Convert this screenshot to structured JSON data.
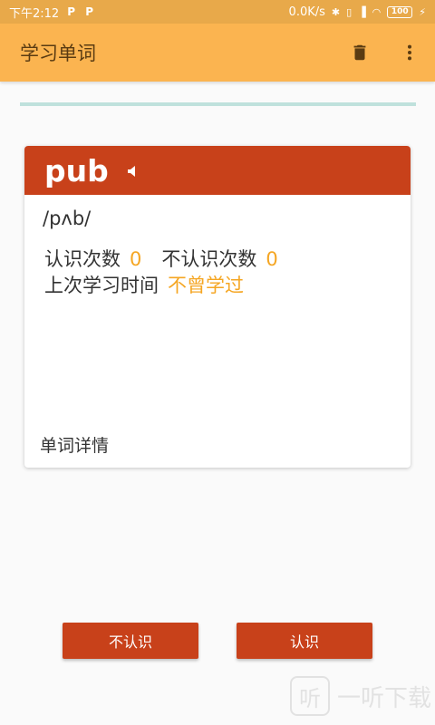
{
  "status_bar": {
    "time": "下午2:12",
    "notif_icons": [
      "P",
      "P"
    ],
    "net_speed": "0.0K/s",
    "battery": "100"
  },
  "app_bar": {
    "title": "学习单词",
    "actions": [
      "trash-icon",
      "more-vert-icon"
    ]
  },
  "card": {
    "word": "pub",
    "phonetic": "/pʌb/",
    "known_label": "认识次数",
    "known_count": "0",
    "unknown_label": "不认识次数",
    "unknown_count": "0",
    "last_study_label": "上次学习时间",
    "last_study_value": "不曾学过",
    "detail_label": "单词详情"
  },
  "buttons": {
    "unknown": "不认识",
    "known": "认识"
  },
  "watermark": {
    "logo_glyph": "听",
    "text": "一听下载"
  },
  "colors": {
    "status_bar": "#e8a94a",
    "app_bar": "#fbb450",
    "primary": "#c8411a",
    "accent": "#f5a623",
    "progress_track": "#bfe1dc"
  }
}
